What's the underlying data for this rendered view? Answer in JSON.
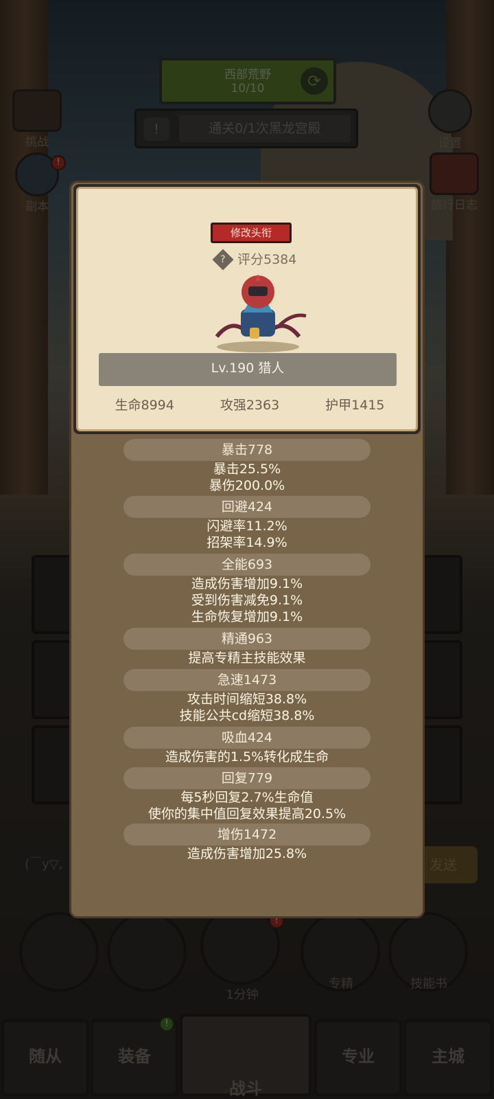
{
  "background": {
    "zone_name": "西部荒野",
    "zone_progress": "10/10",
    "quest_text": "通关0/1次黑龙宫殿",
    "left_buttons": [
      {
        "label": "挑战",
        "badge": false
      },
      {
        "label": "副本",
        "badge": true,
        "badge_text": "!"
      }
    ],
    "right_buttons": [
      {
        "label": "设置"
      },
      {
        "label": "旅行日志"
      }
    ],
    "chat_placeholder": "(￣y▽,",
    "send_label": "发送",
    "circles": [
      {
        "label": ""
      },
      {
        "label": ""
      },
      {
        "label": "1分钟",
        "badge": true
      },
      {
        "label": "专精"
      },
      {
        "label": "技能书"
      }
    ],
    "tabs": [
      {
        "label": "随从"
      },
      {
        "label": "装备",
        "badge": true
      },
      {
        "label": "战斗"
      },
      {
        "label": "专业"
      },
      {
        "label": "主城"
      }
    ]
  },
  "profile": {
    "edit_title_label": "修改头衔",
    "score": "评分5384",
    "level_class": "Lv.190 猎人",
    "hp": "生命8994",
    "attack": "攻强2363",
    "armor": "护甲1415"
  },
  "stats": [
    {
      "header": "暴击778",
      "lines": [
        "暴击25.5%",
        "暴伤200.0%"
      ]
    },
    {
      "header": "回避424",
      "lines": [
        "闪避率11.2%",
        "招架率14.9%"
      ]
    },
    {
      "header": "全能693",
      "lines": [
        "造成伤害增加9.1%",
        "受到伤害减免9.1%",
        "生命恢复增加9.1%"
      ]
    },
    {
      "header": "精通963",
      "lines": [
        "提高专精主技能效果"
      ]
    },
    {
      "header": "急速1473",
      "lines": [
        "攻击时间缩短38.8%",
        "技能公共cd缩短38.8%"
      ]
    },
    {
      "header": "吸血424",
      "lines": [
        "造成伤害的1.5%转化成生命"
      ]
    },
    {
      "header": "回复779",
      "lines": [
        "每5秒回复2.7%生命值",
        "使你的集中值回复效果提高20.5%"
      ]
    },
    {
      "header": "增伤1472",
      "lines": [
        "造成伤害增加25.8%"
      ]
    }
  ]
}
